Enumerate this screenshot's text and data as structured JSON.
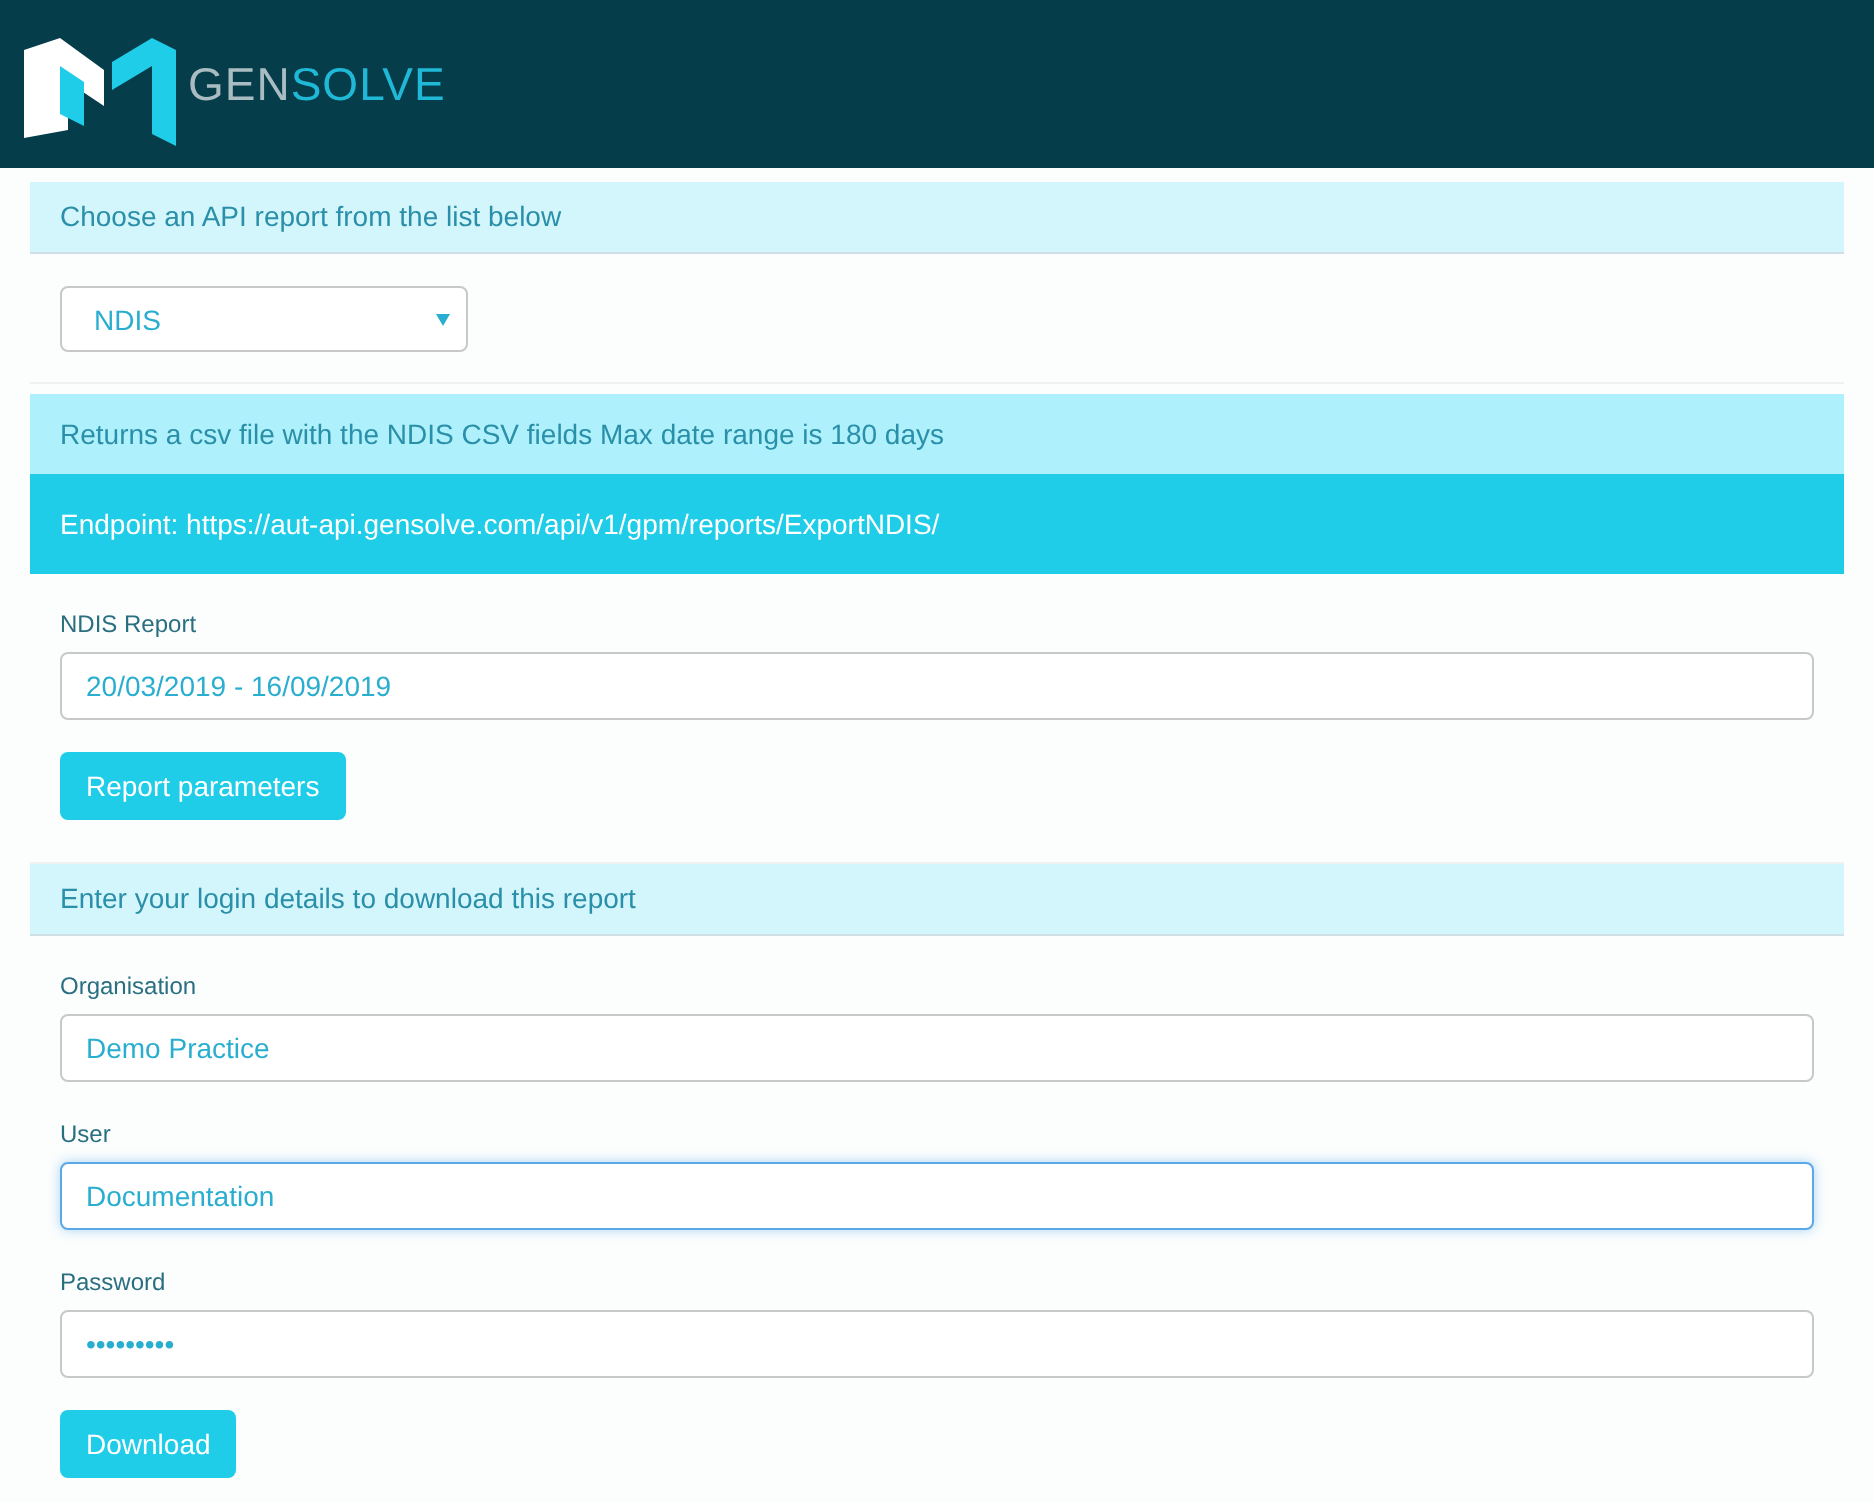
{
  "header": {
    "logo_text": [
      "GEN",
      "SOLVE"
    ]
  },
  "report_section": {
    "heading": "Choose an API report from the list below",
    "report_select": {
      "value": "NDIS"
    }
  },
  "report_info": {
    "description": "Returns a csv file with the NDIS CSV fields Max date range is 180 days",
    "endpoint": "Endpoint: https://aut-api.gensolve.com/api/v1/gpm/reports/ExportNDIS/"
  },
  "parameters": {
    "label": "NDIS Report",
    "value": "20/03/2019 - 16/09/2019",
    "button": "Report parameters"
  },
  "login_section": {
    "heading": "Enter your login details to download this report",
    "fields": [
      {
        "label": "Organisation",
        "value": "Demo Practice",
        "focused": false
      },
      {
        "label": "User",
        "value": "Documentation",
        "focused": true
      },
      {
        "label": "Password",
        "value": "•••••••••",
        "focused": false
      }
    ],
    "button": "Download"
  }
}
